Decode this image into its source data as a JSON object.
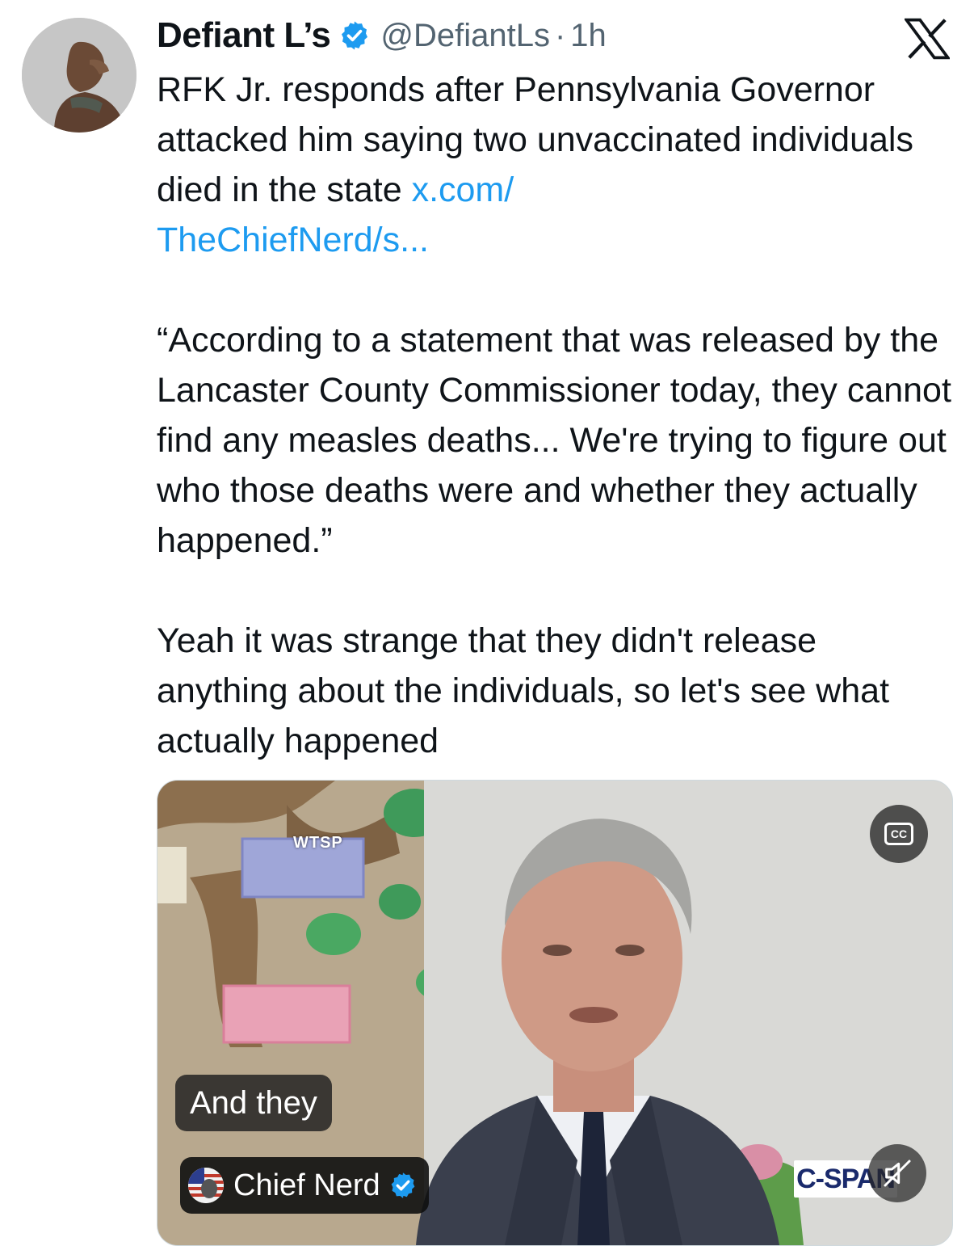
{
  "tweet": {
    "display_name": "Defiant L’s",
    "handle": "@DefiantLs",
    "separator": "·",
    "time": "1h",
    "text_part1": "RFK Jr. responds after Pennsylvania Governor attacked him saying two unvaccinated individuals died in the state ",
    "link_text": "x.com/\nTheChiefNerd/s...",
    "text_part2": "\n\n“According to a statement that was released by the Lancaster County Commissioner today, they cannot find any measles deaths... We're trying to figure out who those deaths were and whether they actually happened.”\n\nYeah it was strange that they didn't release anything about the individuals, so let's see what actually happened"
  },
  "media": {
    "watermark": "WTSP",
    "cc_label": "CC",
    "caption": "And they",
    "attribution_name": "Chief Nerd",
    "network_logo": "C-SPAN"
  },
  "colors": {
    "link": "#1d9bf0",
    "verified": "#1d9bf0",
    "text": "#0f1419",
    "muted": "#536471"
  },
  "icons": {
    "brand": "x-logo-icon",
    "verified": "verified-badge-icon",
    "captions": "closed-captions-icon",
    "mute": "volume-muted-icon"
  }
}
